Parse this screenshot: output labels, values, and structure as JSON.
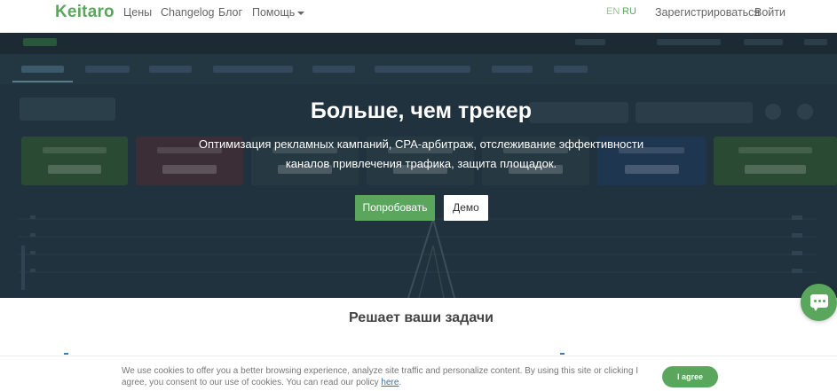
{
  "nav": {
    "logo": "Keitaro",
    "links": {
      "prices": "Цены",
      "changelog": "Changelog",
      "blog": "Блог",
      "help": "Помощь"
    },
    "lang_en": "EN",
    "lang_ru": "RU",
    "register": "Зарегистрироваться",
    "login": "Войти"
  },
  "hero": {
    "title": "Больше, чем трекер",
    "subtitle": "Оптимизация рекламных кампаний, CPA-арбитраж, отслеживание эффективности каналов привлечения трафика, защита площадок.",
    "try_button": "Попробовать",
    "demo_button": "Демо"
  },
  "section": {
    "title": "Решает ваши задачи"
  },
  "cookie": {
    "text": "We use cookies to offer you a better browsing experience, analyze site traffic and personalize content. By using this site or clicking I agree, you consent to our use of cookies. You can read our policy",
    "link": "here",
    "suffix": ".",
    "agree_button": "I agree"
  },
  "colors": {
    "brand_green": "#5aa65d",
    "hero_overlay": "#20323d",
    "link_blue": "#3a6ea8"
  },
  "icons": {
    "help_dropdown": "caret-down-icon",
    "chat": "chat-bubble-icon"
  }
}
